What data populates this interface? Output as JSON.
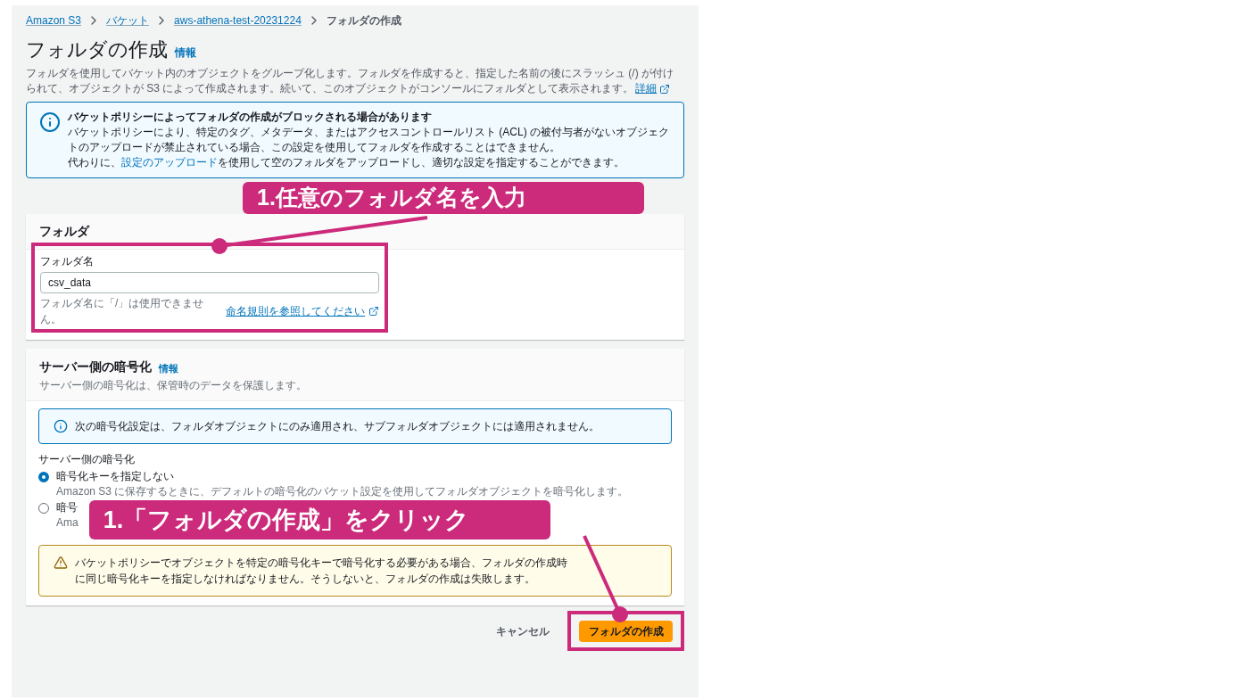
{
  "breadcrumb": [
    {
      "label": "Amazon S3",
      "link": true
    },
    {
      "label": "バケット",
      "link": true
    },
    {
      "label": "aws-athena-test-20231224",
      "link": true
    },
    {
      "label": "フォルダの作成",
      "link": false
    }
  ],
  "page": {
    "title": "フォルダの作成",
    "info_link": "情報",
    "description": "フォルダを使用してバケット内のオブジェクトをグループ化します。フォルダを作成すると、指定した名前の後にスラッシュ (/) が付けられて、オブジェクトが S3 によって作成されます。続いて、このオブジェクトがコンソールにフォルダとして表示されます。",
    "details_link": "詳細"
  },
  "policy_alert": {
    "title": "バケットポリシーによってフォルダの作成がブロックされる場合があります",
    "body": "バケットポリシーにより、特定のタグ、メタデータ、またはアクセスコントロールリスト (ACL) の被付与者がないオブジェクトのアップロードが禁止されている場合、この設定を使用してフォルダを作成することはできません。",
    "body_before_link": "代わりに、",
    "link": "設定のアップロード",
    "body_after_link": "を使用して空のフォルダをアップロードし、適切な設定を指定することができます。"
  },
  "folder_panel": {
    "title": "フォルダ",
    "field_label": "フォルダ名",
    "value": "csv_data",
    "hint": "フォルダ名に「/」は使用できません。",
    "hint_link": "命名規則を参照してください"
  },
  "encryption_panel": {
    "title": "サーバー側の暗号化",
    "info_link": "情報",
    "description": "サーバー側の暗号化は、保管時のデータを保護します。",
    "alerts": [
      {
        "kind": "info",
        "text": "次の暗号化設定は、フォルダオブジェクトにのみ適用され、サブフォルダオブジェクトには適用されません。"
      }
    ],
    "group_label": "サーバー側の暗号化",
    "options": [
      {
        "label": "暗号化キーを指定しない",
        "description": "Amazon S3 に保存するときに、デフォルトの暗号化のバケット設定を使用してフォルダオブジェクトを暗号化します。",
        "selected": true
      },
      {
        "label": "暗号",
        "description": "Ama",
        "selected": false
      }
    ],
    "warnings": [
      {
        "kind": "warning",
        "text": "バケットポリシーでオブジェクトを特定の暗号化キーで暗号化する必要がある場合、フォルダの作成時に同じ暗号化キーを指定しなければなりません。そうしないと、フォルダの作成は失敗します。"
      }
    ]
  },
  "actions": {
    "cancel": "キャンセル",
    "submit": "フォルダの作成"
  },
  "callouts": [
    {
      "text": "1.任意のフォルダ名を入力"
    },
    {
      "text": "1.「フォルダの作成」をクリック"
    }
  ]
}
